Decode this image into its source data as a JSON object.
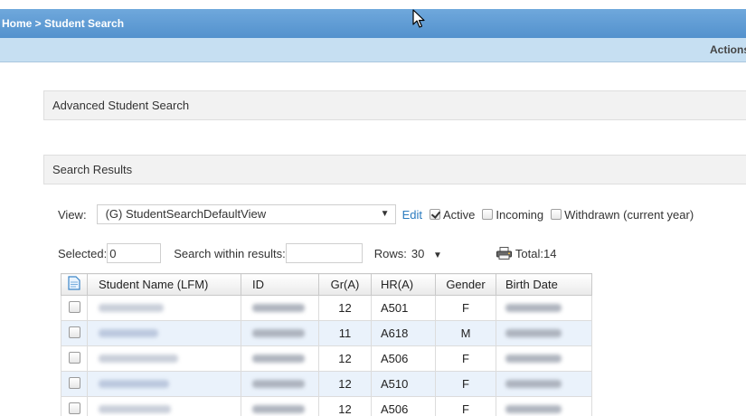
{
  "breadcrumb": {
    "home": "Home",
    "separator": " > ",
    "current": "Student Search"
  },
  "actionbar": {
    "actions_label": "Actions"
  },
  "sections": {
    "advanced": "Advanced Student Search",
    "results": "Search Results"
  },
  "view_row": {
    "view_label": "View:",
    "view_selected": "(G) StudentSearchDefaultView",
    "edit_label": "Edit",
    "active_label": "Active",
    "active_checked": true,
    "incoming_label": "Incoming",
    "incoming_checked": false,
    "withdrawn_label": "Withdrawn (current year)",
    "withdrawn_checked": false
  },
  "controls_row": {
    "selected_label": "Selected:",
    "selected_value": "0",
    "search_within_label": "Search within results:",
    "search_within_value": "",
    "rows_label": "Rows:",
    "rows_value": "30",
    "total_label": "Total:",
    "total_value": "14"
  },
  "table": {
    "columns": [
      "",
      "Student Name (LFM)",
      "ID",
      "Gr(A)",
      "HR(A)",
      "Gender",
      "Birth Date"
    ],
    "rows": [
      {
        "grade": "12",
        "homeroom": "A501",
        "gender": "F"
      },
      {
        "grade": "11",
        "homeroom": "A618",
        "gender": "M"
      },
      {
        "grade": "12",
        "homeroom": "A506",
        "gender": "F"
      },
      {
        "grade": "12",
        "homeroom": "A510",
        "gender": "F"
      },
      {
        "grade": "12",
        "homeroom": "A506",
        "gender": "F"
      }
    ]
  },
  "colors": {
    "header_blue": "#4b8bc9",
    "subbar_blue": "#c6dff2",
    "link_blue": "#2a7bbf",
    "even_row": "#eaf2fb"
  },
  "icons": {
    "cursor": "mouse-pointer-icon",
    "printer": "printer-icon",
    "export": "document-icon",
    "dropdown": "caret-down-icon"
  }
}
